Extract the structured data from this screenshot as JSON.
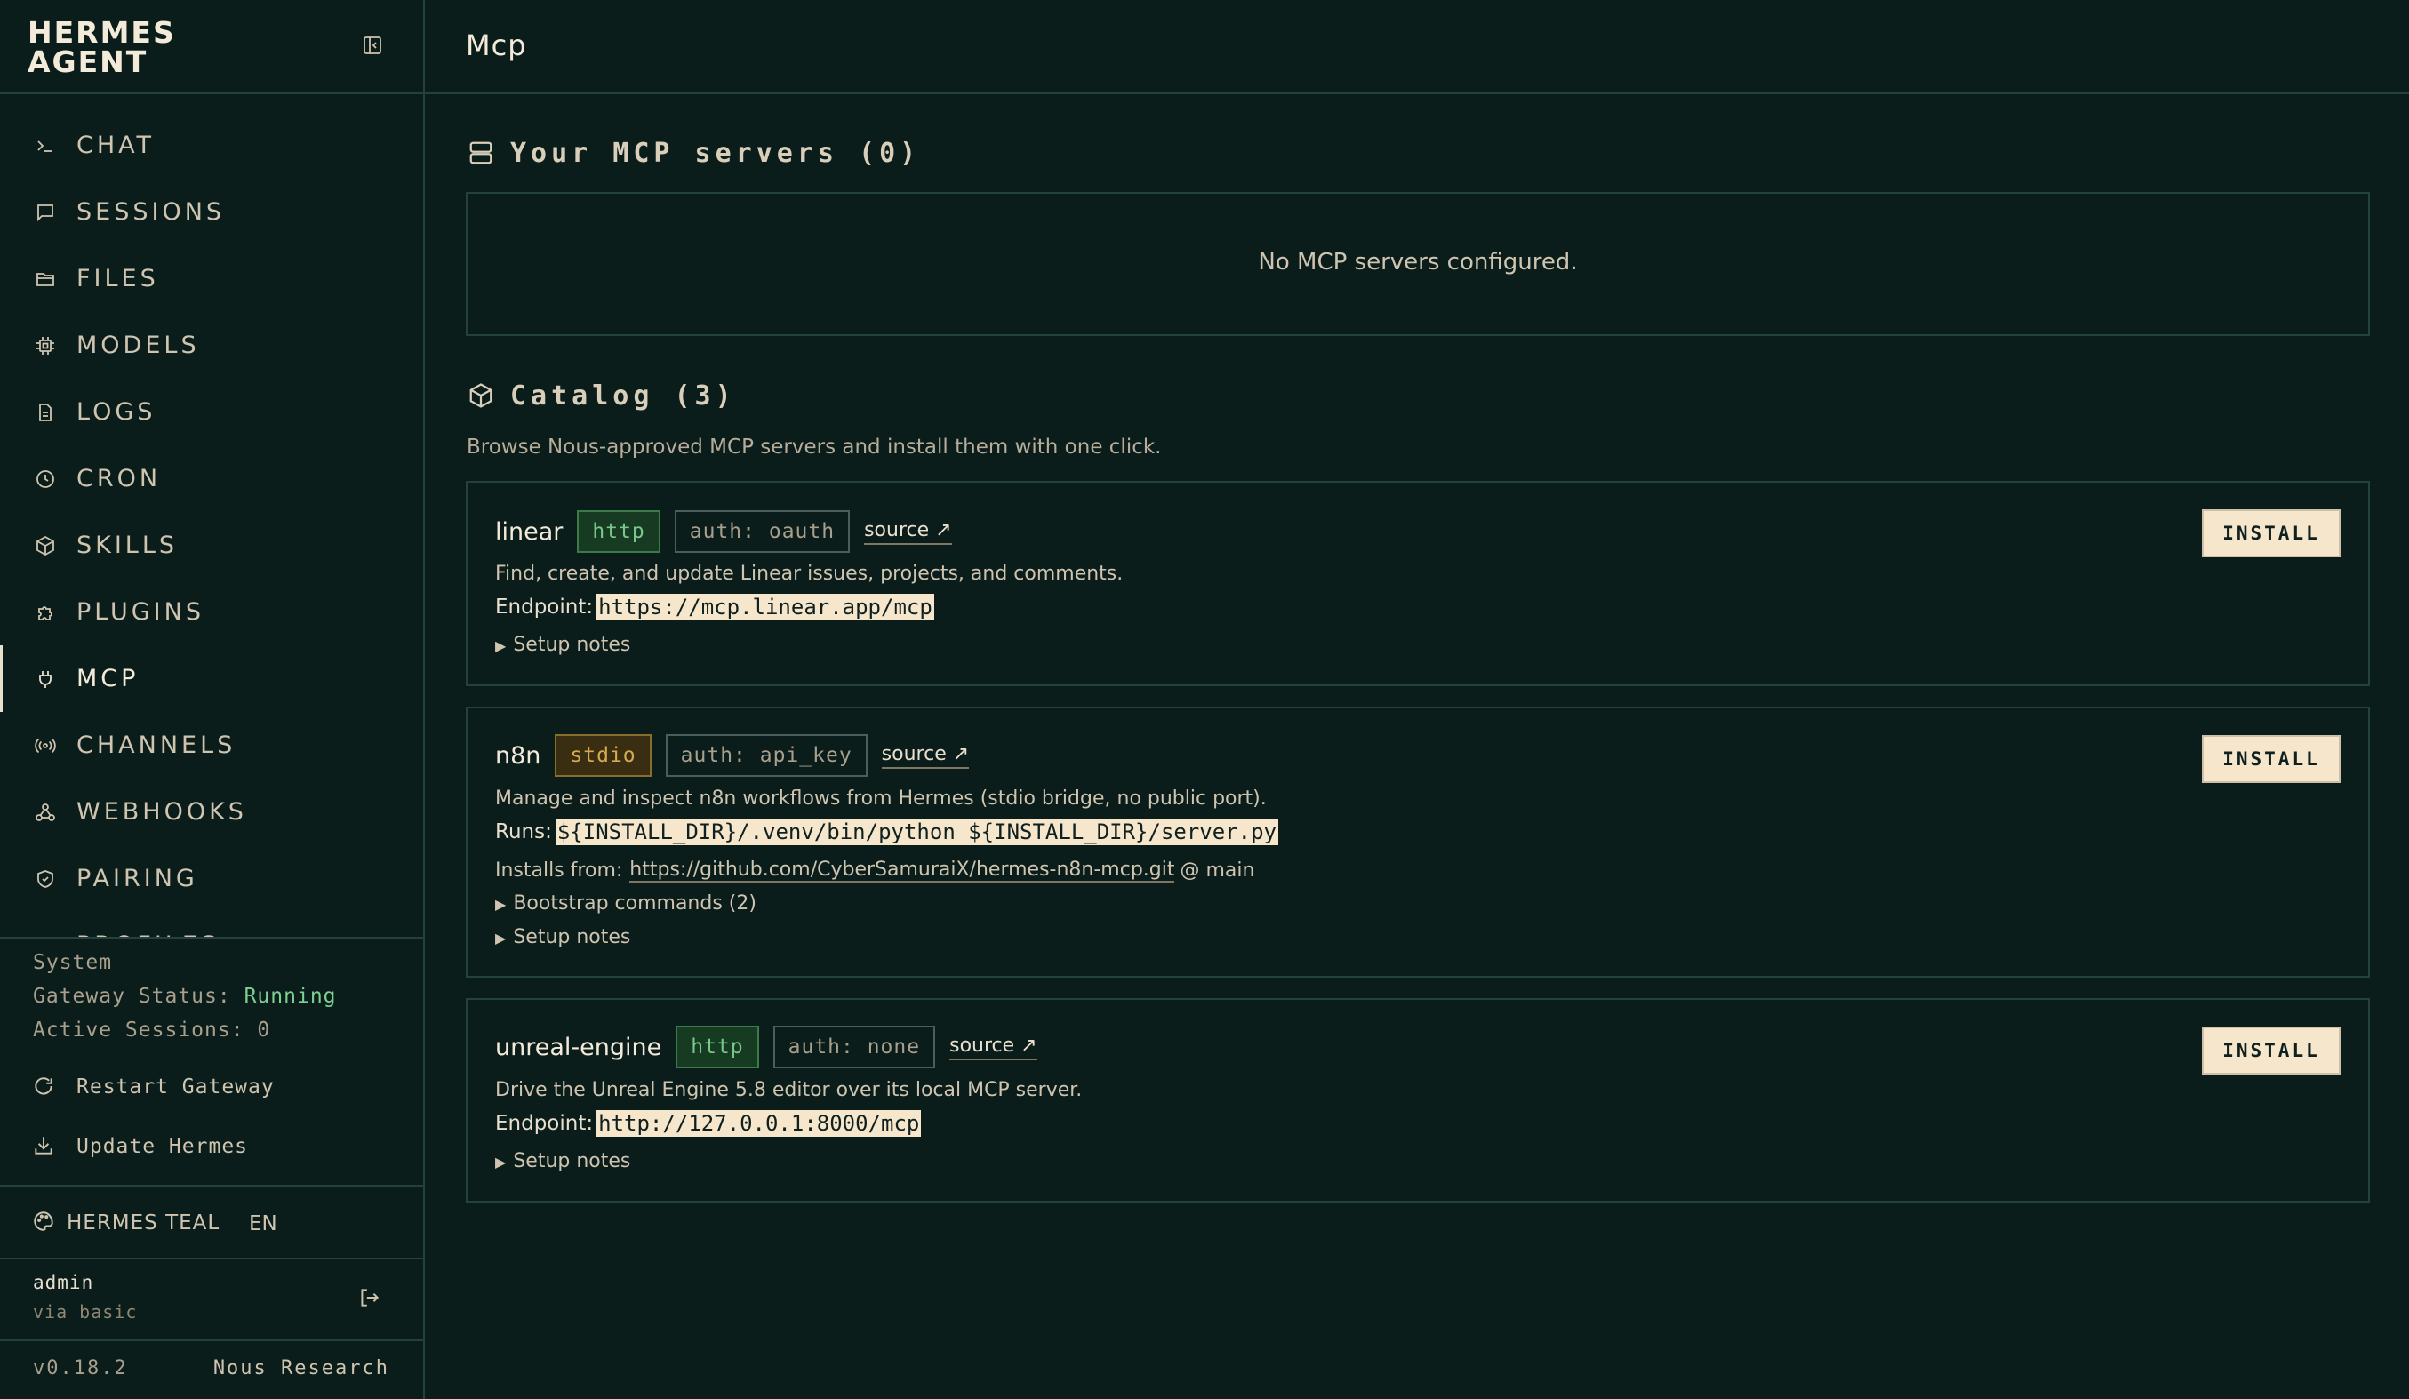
{
  "brand": {
    "line1": "HERMES",
    "line2": "AGENT"
  },
  "nav": [
    {
      "label": "CHAT",
      "icon": "terminal-icon"
    },
    {
      "label": "SESSIONS",
      "icon": "chat-bubble-icon"
    },
    {
      "label": "FILES",
      "icon": "folder-icon"
    },
    {
      "label": "MODELS",
      "icon": "chip-icon"
    },
    {
      "label": "LOGS",
      "icon": "document-icon"
    },
    {
      "label": "CRON",
      "icon": "clock-icon"
    },
    {
      "label": "SKILLS",
      "icon": "package-icon"
    },
    {
      "label": "PLUGINS",
      "icon": "puzzle-icon"
    },
    {
      "label": "MCP",
      "icon": "plug-icon",
      "active": true
    },
    {
      "label": "CHANNELS",
      "icon": "broadcast-icon"
    },
    {
      "label": "WEBHOOKS",
      "icon": "webhook-icon"
    },
    {
      "label": "PAIRING",
      "icon": "shield-icon"
    },
    {
      "label": "PROFILES",
      "icon": "user-icon"
    }
  ],
  "system": {
    "title": "System",
    "gateway_label": "Gateway Status:",
    "gateway_value": "Running",
    "sessions_label": "Active Sessions:",
    "sessions_value": "0",
    "restart_label": "Restart Gateway",
    "update_label": "Update Hermes"
  },
  "theme": {
    "label": "HERMES TEAL",
    "lang": "EN"
  },
  "user": {
    "name": "admin",
    "via": "via basic"
  },
  "footer": {
    "version": "v0.18.2",
    "vendor": "Nous Research"
  },
  "page": {
    "title": "Mcp"
  },
  "servers": {
    "heading": "Your MCP servers (0)",
    "empty": "No MCP servers configured."
  },
  "catalog": {
    "heading": "Catalog (3)",
    "subtitle": "Browse Nous-approved MCP servers and install them with one click.",
    "install_label": "INSTALL",
    "source_label": "source ↗",
    "items": [
      {
        "name": "linear",
        "transport": "http",
        "auth": "auth: oauth",
        "description": "Find, create, and update Linear issues, projects, and comments.",
        "endpoint_label": "Endpoint:",
        "endpoint": "https://mcp.linear.app/mcp",
        "setup_notes": "Setup notes"
      },
      {
        "name": "n8n",
        "transport": "stdio",
        "auth": "auth: api_key",
        "description": "Manage and inspect n8n workflows from Hermes (stdio bridge, no public port).",
        "runs_label": "Runs:",
        "runs": "${INSTALL_DIR}/.venv/bin/python ${INSTALL_DIR}/server.py",
        "installs_label": "Installs from:",
        "installs_url": "https://github.com/CyberSamuraiX/hermes-n8n-mcp.git",
        "installs_ref": "@ main",
        "bootstrap": "Bootstrap commands (2)",
        "setup_notes": "Setup notes"
      },
      {
        "name": "unreal-engine",
        "transport": "http",
        "auth": "auth: none",
        "description": "Drive the Unreal Engine 5.8 editor over its local MCP server.",
        "endpoint_label": "Endpoint:",
        "endpoint": "http://127.0.0.1:8000/mcp",
        "setup_notes": "Setup notes"
      }
    ]
  },
  "colors": {
    "background": "#0a1d1b",
    "border": "#24413d",
    "text": "#e9dfce",
    "accent_green": "#7fd08f",
    "button_bg": "#f6e6cc",
    "badge_http": "#79c88a",
    "badge_stdio": "#d7aa4d"
  }
}
